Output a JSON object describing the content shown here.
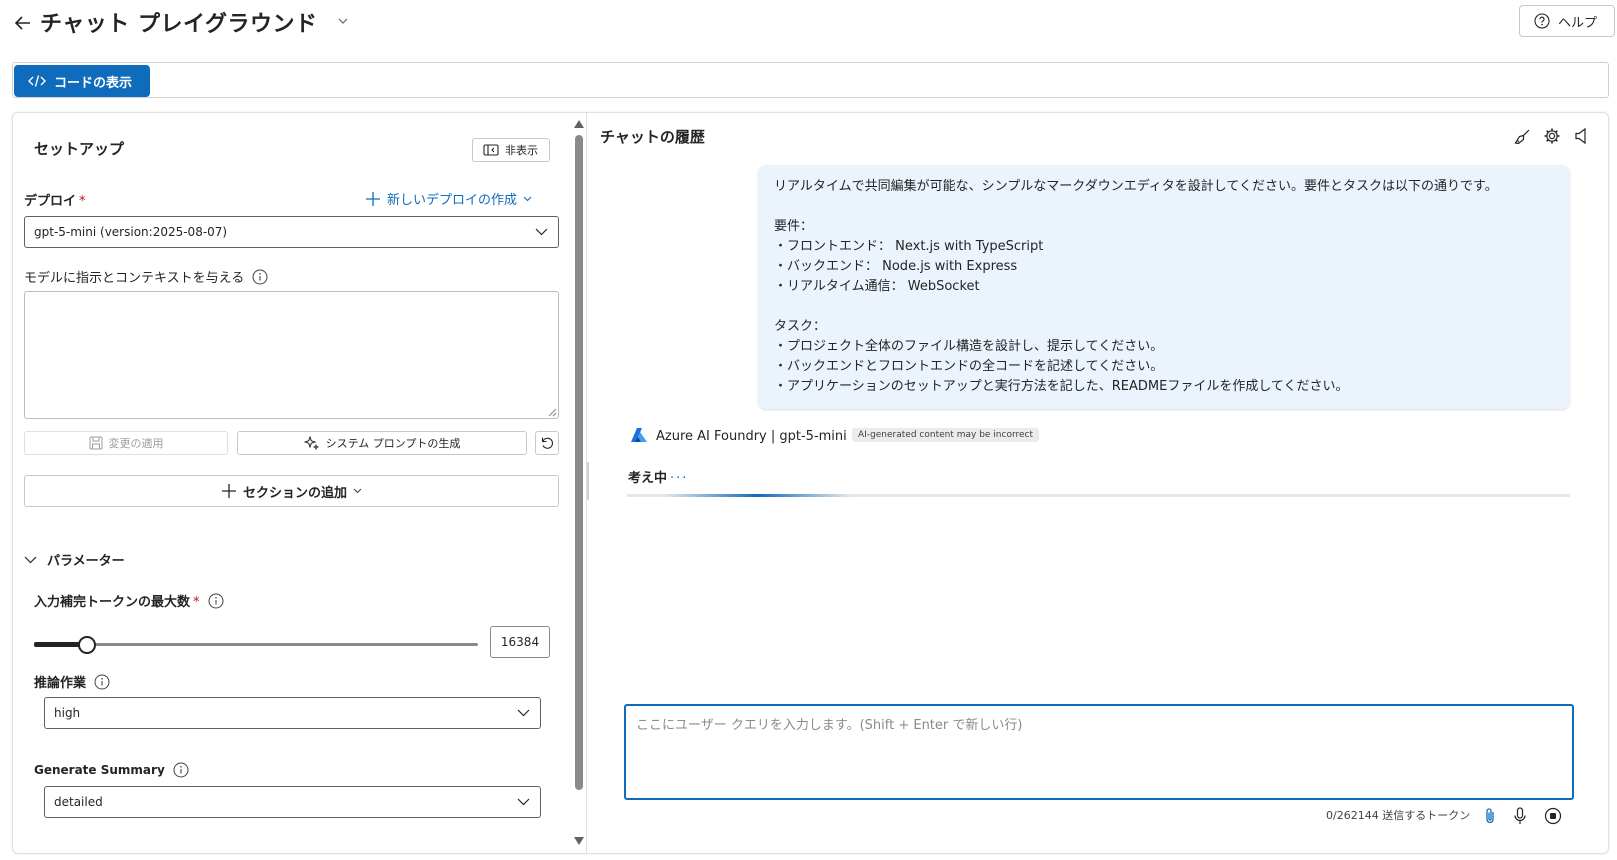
{
  "header": {
    "title": "チャット プレイグラウンド",
    "help_label": "ヘルプ"
  },
  "toolbar": {
    "view_code_label": "コードの表示"
  },
  "setup": {
    "title": "セットアップ",
    "hide_label": "非表示",
    "deploy_label": "デプロイ",
    "required_mark": "*",
    "new_deploy_label": "新しいデプロイの作成",
    "deploy_value": "gpt-5-mini (version:2025-08-07)",
    "instructions_label": "モデルに指示とコンテキストを与える",
    "instructions_value": "",
    "apply_label": "変更の適用",
    "generate_label": "システム プロンプトの生成",
    "add_section_label": "セクションの追加"
  },
  "parameters": {
    "title": "パラメーター",
    "max_tokens_label": "入力補完トークンの最大数",
    "max_tokens_value": "16384",
    "max_tokens_fraction": 0.12,
    "reasoning_label": "推論作業",
    "reasoning_value": "high",
    "summary_label": "Generate Summary",
    "summary_value": "detailed"
  },
  "chat": {
    "title": "チャットの履歴",
    "user_message": "リアルタイムで共同編集が可能な、シンプルなマークダウンエディタを設計してください。要件とタスクは以下の通りです。\n\n要件：\n・フロントエンド： Next.js with TypeScript\n・バックエンド： Node.js with Express\n・リアルタイム通信： WebSocket\n\nタスク：\n・プロジェクト全体のファイル構造を設計し、提示してください。\n・バックエンドとフロントエンドの全コードを記述してください。\n・アプリケーションのセットアップと実行方法を記した、READMEファイルを作成してください。",
    "assistant_name": "Azure AI Foundry | gpt-5-mini",
    "ai_badge": "AI-generated content may be incorrect",
    "thinking_label": "考え中",
    "thinking_dots": "...",
    "input_placeholder": "ここにユーザー クエリを入力します。(Shift + Enter で新しい行)",
    "token_counter": "0/262144 送信するトークン"
  },
  "colors": {
    "accent": "#0f6cbd",
    "user_bubble": "#ebf3fc",
    "required": "#c50f1f"
  },
  "icons": [
    "back-arrow-icon",
    "chevron-down-icon",
    "help-icon",
    "code-icon",
    "panel-hide-icon",
    "plus-icon",
    "info-icon",
    "save-icon",
    "sparkle-icon",
    "reset-icon",
    "broom-icon",
    "gear-icon",
    "speaker-icon",
    "azure-logo-icon",
    "attach-icon",
    "mic-icon",
    "stop-icon"
  ]
}
